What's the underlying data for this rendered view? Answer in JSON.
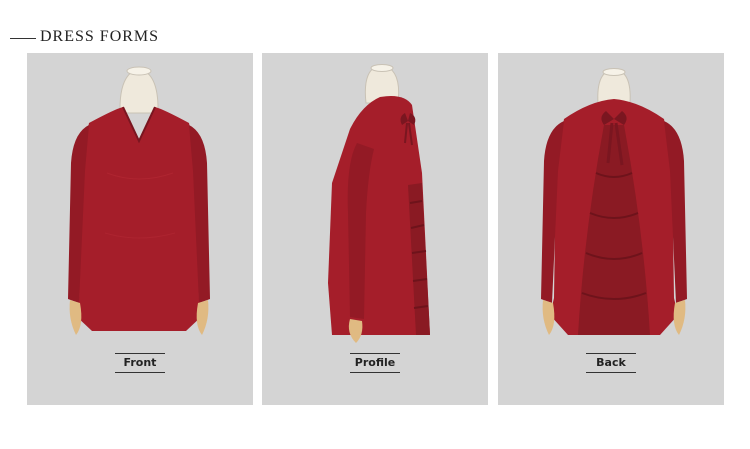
{
  "header": {
    "title": "DRESS FORMS"
  },
  "views": [
    {
      "label": "Front"
    },
    {
      "label": "Profile"
    },
    {
      "label": "Back"
    }
  ],
  "colors": {
    "panel_bg": "#d4d4d4",
    "garment": "#a51e2a",
    "mannequin": "#efe9dc",
    "hand": "#e0ba82"
  }
}
